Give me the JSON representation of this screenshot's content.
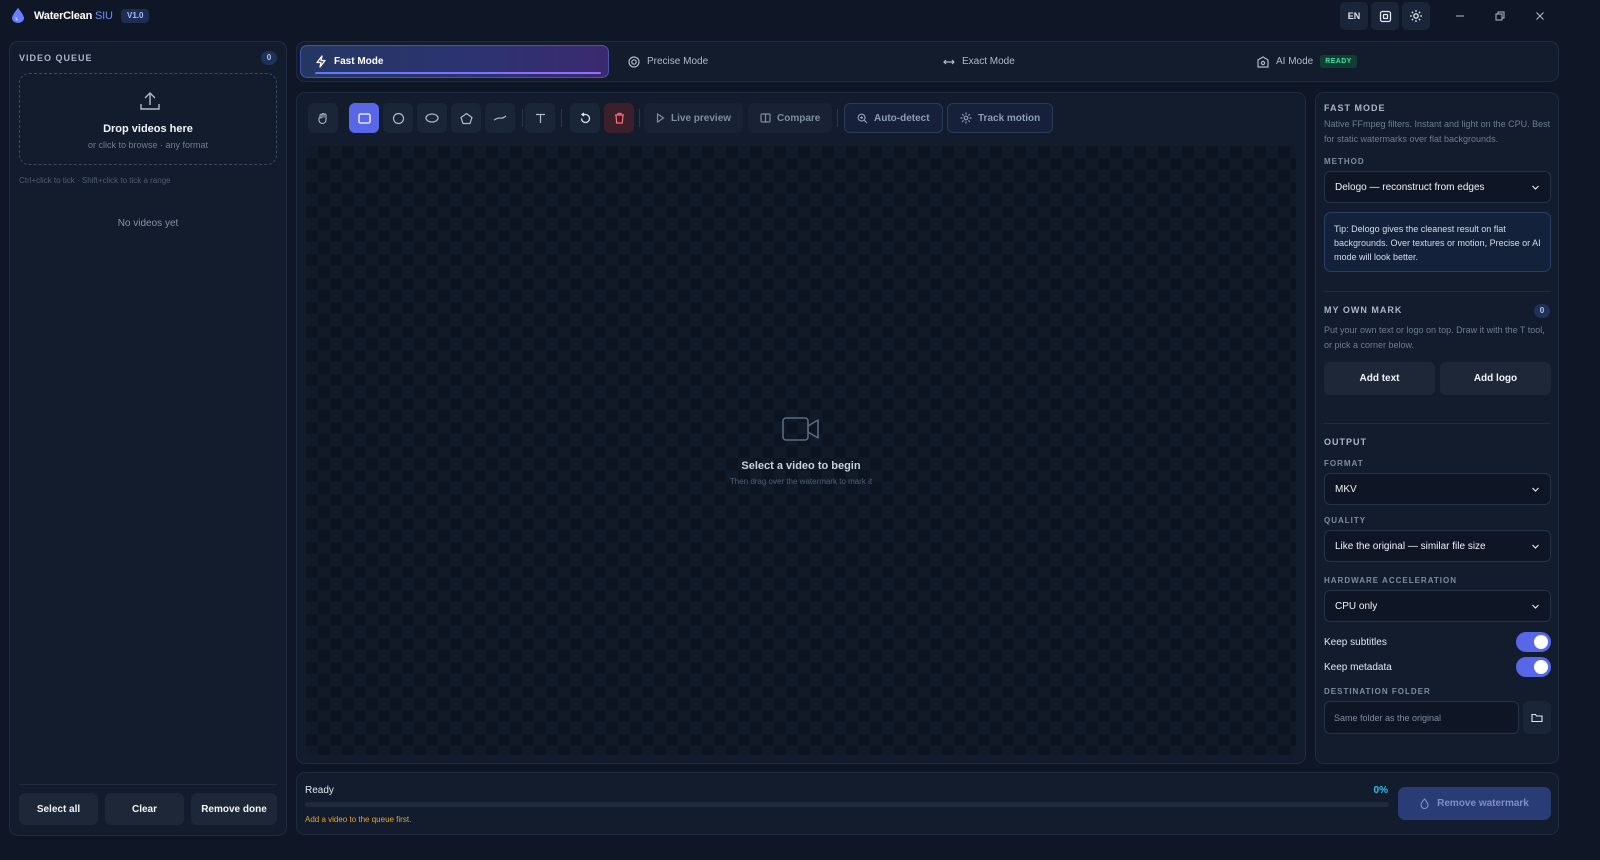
{
  "app": {
    "name": "WaterClean",
    "name_suffix": " SIU",
    "version": "V1.0",
    "language": "EN"
  },
  "queue": {
    "heading": "VIDEO QUEUE",
    "count": "0",
    "drop_title": "Drop videos here",
    "drop_subtitle": "or click to browse · any format",
    "hint": "Ctrl+click to tick · Shift+click to tick a range",
    "empty": "No videos yet",
    "buttons": {
      "select_all": "Select all",
      "clear": "Clear",
      "remove_done": "Remove done"
    }
  },
  "modes": {
    "fast": "Fast Mode",
    "precise": "Precise Mode",
    "exact": "Exact Mode",
    "ai": "AI Mode",
    "ai_badge": "READY",
    "active": "fast"
  },
  "toolbar": {
    "tools": [
      "hand-icon",
      "rectangle-icon",
      "circle-icon",
      "ellipse-icon",
      "polygon-icon",
      "brush-icon",
      "text-icon",
      "undo-icon",
      "trash-icon"
    ],
    "active_tool": "rectangle",
    "live_preview": "Live preview",
    "compare": "Compare",
    "auto_detect": "Auto-detect",
    "track_motion": "Track motion"
  },
  "stage": {
    "title": "Select a video to begin",
    "subtitle": "Then drag over the watermark to mark it"
  },
  "settings": {
    "fast_heading": "FAST MODE",
    "fast_desc": "Native FFmpeg filters. Instant and light on the CPU. Best for static watermarks over flat backgrounds.",
    "method_label": "METHOD",
    "method_value": "Delogo — reconstruct from edges",
    "tip": "Tip: Delogo gives the cleanest result on flat backgrounds. Over textures or motion, Precise or AI mode will look better.",
    "own_mark_heading": "MY OWN MARK",
    "own_mark_count": "0",
    "own_mark_desc": "Put your own text or logo on top. Draw it with the T tool, or pick a corner below.",
    "add_text": "Add text",
    "add_logo": "Add logo",
    "output_heading": "OUTPUT",
    "format_label": "FORMAT",
    "format_value": "MKV",
    "quality_label": "QUALITY",
    "quality_value": "Like the original — similar file size",
    "hw_label": "HARDWARE ACCELERATION",
    "hw_value": "CPU only",
    "keep_subtitles": "Keep subtitles",
    "keep_subtitles_on": true,
    "keep_metadata": "Keep metadata",
    "keep_metadata_on": true,
    "dest_label": "DESTINATION FOLDER",
    "dest_placeholder": "Same folder as the original"
  },
  "status": {
    "text": "Ready",
    "progress_label": "0%",
    "progress": 0,
    "warning": "Add a video to the queue first.",
    "remove_button": "Remove watermark"
  },
  "colors": {
    "accent": "#5866e8",
    "progress": "#2fc3f0",
    "ready_badge": "#3ee0a2",
    "warning": "#e6a42a"
  }
}
